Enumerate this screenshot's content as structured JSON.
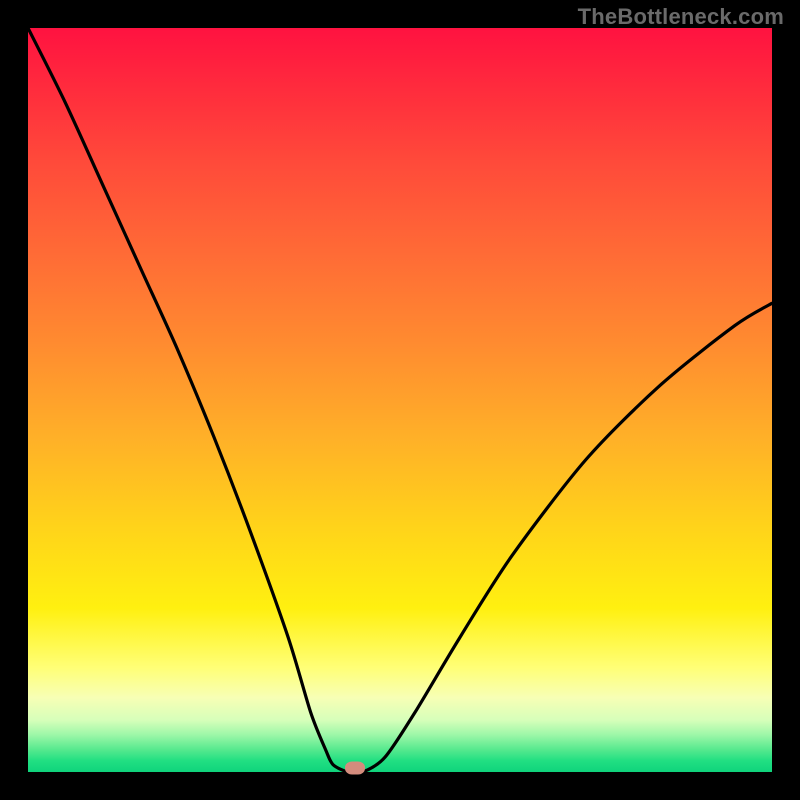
{
  "watermark": "TheBottleneck.com",
  "colors": {
    "frame_bg": "#000000",
    "gradient_top": "#ff1240",
    "gradient_mid": "#ffd31a",
    "gradient_bottom": "#0fd37c",
    "curve_stroke": "#000000",
    "marker_fill": "#d48c7d",
    "watermark_color": "#6a6a6a"
  },
  "chart_data": {
    "type": "line",
    "title": "",
    "xlabel": "",
    "ylabel": "",
    "xlim": [
      0,
      100
    ],
    "ylim": [
      0,
      100
    ],
    "note": "V-shaped bottleneck curve. x is relative horizontal position (0=left,100=right). y is bottleneck percentage (0=no bottleneck at valley, 100=max at top).",
    "series": [
      {
        "name": "bottleneck-curve",
        "x": [
          0,
          5,
          10,
          15,
          20,
          25,
          30,
          35,
          38,
          40,
          41,
          43,
          45,
          48,
          52,
          58,
          65,
          75,
          85,
          95,
          100
        ],
        "y": [
          100,
          90,
          79,
          68,
          57,
          45,
          32,
          18,
          8,
          3,
          1,
          0,
          0,
          2,
          8,
          18,
          29,
          42,
          52,
          60,
          63
        ]
      }
    ],
    "annotations": [
      {
        "name": "optimal-marker",
        "x": 44,
        "y": 0.5,
        "label": ""
      }
    ],
    "gradient_bands": [
      {
        "from_y": 100,
        "to_y": 15,
        "meaning": "high bottleneck (red→orange→yellow)"
      },
      {
        "from_y": 15,
        "to_y": 5,
        "meaning": "low bottleneck (pale yellow)"
      },
      {
        "from_y": 5,
        "to_y": 0,
        "meaning": "no bottleneck (green)"
      }
    ]
  }
}
